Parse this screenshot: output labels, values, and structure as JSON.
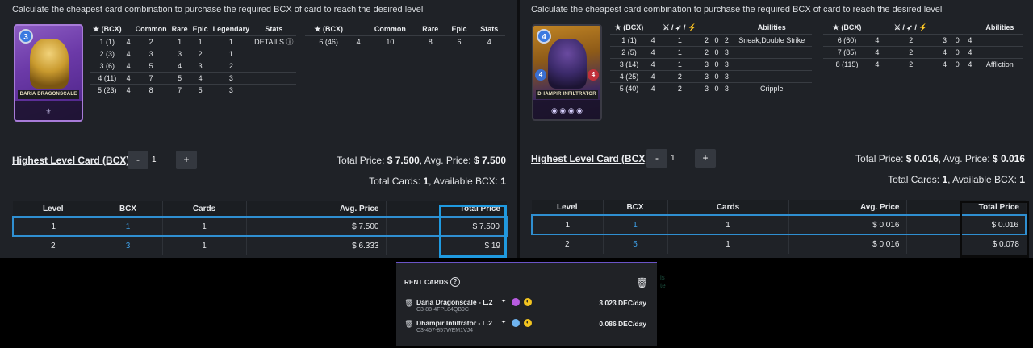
{
  "left": {
    "description": "Calculate the cheapest card combination to purchase the required BCX of card to reach the desired level",
    "card": {
      "name": "Daria Dragonscale",
      "mana": "3",
      "stars": "★6"
    },
    "level_table": {
      "headers": [
        "(BCX)",
        "",
        "Common",
        "Rare",
        "Epic",
        "Legendary",
        "Stats"
      ],
      "rows": [
        [
          "1 (1)",
          "4",
          "2",
          "1",
          "1",
          "1",
          "DETAILS"
        ],
        [
          "2 (3)",
          "4",
          "3",
          "3",
          "2",
          "1",
          ""
        ],
        [
          "3 (6)",
          "4",
          "5",
          "4",
          "3",
          "2",
          ""
        ],
        [
          "4 (11)",
          "4",
          "7",
          "5",
          "4",
          "3",
          ""
        ],
        [
          "5 (23)",
          "4",
          "8",
          "7",
          "5",
          "3",
          ""
        ]
      ]
    },
    "level_table2": {
      "headers": [
        "(BCX)",
        "",
        "Common",
        "Rare",
        "Epic",
        "Stats"
      ],
      "rows": [
        [
          "6 (46)",
          "4",
          "10",
          "8",
          "6",
          "4"
        ]
      ]
    },
    "highest_label": "Highest Level Card (BCX)",
    "qty": "1",
    "minus": "-",
    "plus": "+",
    "total_price_label": "Total Price:",
    "total_price": "$ 7.500",
    "avg_price_label": ", Avg. Price:",
    "avg_price": "$ 7.500",
    "total_cards_label": "Total Cards:",
    "total_cards": "1",
    "avail_bcx_label": ", Available BCX:",
    "avail_bcx": "1",
    "grid_headers": [
      "Level",
      "BCX",
      "Cards",
      "Avg. Price",
      "Total Price"
    ],
    "grid_rows": [
      [
        "1",
        "1",
        "1",
        "$ 7.500",
        "$ 7.500"
      ],
      [
        "2",
        "3",
        "1",
        "$ 6.333",
        "$ 19"
      ]
    ]
  },
  "right": {
    "description": "Calculate the cheapest card combination to purchase the required BCX of card to reach the desired level",
    "card": {
      "name": "Dhampir Infiltrator",
      "mana": "4",
      "health": "4",
      "armor": "4"
    },
    "level_table": {
      "headers": [
        "(BCX)",
        "",
        "⚔ / ➶ / ⚡",
        "",
        "",
        "",
        "Abilities"
      ],
      "rows": [
        [
          "1 (1)",
          "4",
          "1",
          "2",
          "0",
          "2",
          "Sneak,Double Strike"
        ],
        [
          "2 (5)",
          "4",
          "1",
          "2",
          "0",
          "3",
          ""
        ],
        [
          "3 (14)",
          "4",
          "1",
          "3",
          "0",
          "3",
          ""
        ],
        [
          "4 (25)",
          "4",
          "2",
          "3",
          "0",
          "3",
          ""
        ],
        [
          "5 (40)",
          "4",
          "2",
          "3",
          "0",
          "3",
          "Cripple"
        ]
      ]
    },
    "level_table2": {
      "headers": [
        "(BCX)",
        "",
        "⚔ / ➶ / ⚡",
        "",
        "",
        "",
        "Abilities"
      ],
      "rows": [
        [
          "6 (60)",
          "4",
          "2",
          "3",
          "0",
          "4",
          ""
        ],
        [
          "7 (85)",
          "4",
          "2",
          "4",
          "0",
          "4",
          ""
        ],
        [
          "8 (115)",
          "4",
          "2",
          "4",
          "0",
          "4",
          "Affliction"
        ]
      ]
    },
    "highest_label": "Highest Level Card (BCX)",
    "qty": "1",
    "minus": "-",
    "plus": "+",
    "total_price_label": "Total Price:",
    "total_price": "$ 0.016",
    "avg_price_label": ", Avg. Price:",
    "avg_price": "$ 0.016",
    "total_cards_label": "Total Cards:",
    "total_cards": "1",
    "avail_bcx_label": ", Available BCX:",
    "avail_bcx": "1",
    "grid_headers": [
      "Level",
      "BCX",
      "Cards",
      "Avg. Price",
      "Total Price"
    ],
    "grid_rows": [
      [
        "1",
        "1",
        "1",
        "$ 0.016",
        "$ 0.016"
      ],
      [
        "2",
        "5",
        "1",
        "$ 0.016",
        "$ 0.078"
      ]
    ]
  },
  "rent": {
    "title": "RENT CARDS",
    "items": [
      {
        "name": "Daria Dragonscale - L.2",
        "id": "C3-88-4FPL84QB9C",
        "price": "3.023 DEC/day",
        "color": "#b85ce0"
      },
      {
        "name": "Dhampir Infiltrator - L.2",
        "id": "C3-457-857WEM1VJ4",
        "price": "0.086 DEC/day",
        "color": "#6fb4f0"
      }
    ]
  },
  "colors": {
    "accent": "#1f9ae0",
    "panel": "#1f2227",
    "link": "#3ea0e8"
  }
}
